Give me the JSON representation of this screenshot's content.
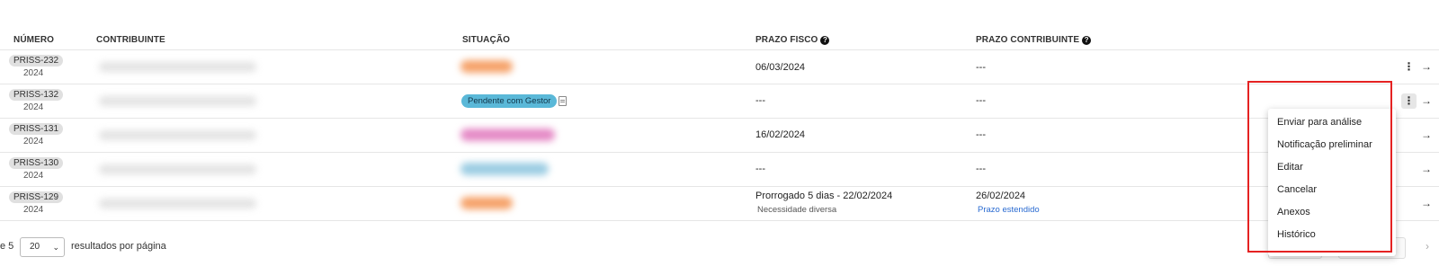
{
  "table": {
    "headers": {
      "numero": "NÚMERO",
      "contribuinte": "CONTRIBUINTE",
      "situacao": "SITUAÇÃO",
      "prazo_fisco": "PRAZO FISCO",
      "prazo_contribuinte": "PRAZO CONTRIBUINTE"
    },
    "rows": [
      {
        "id": "PRISS-232",
        "year": "2024",
        "prazo_fisco": "06/03/2024",
        "prazo_fisco_note": "",
        "prazo_contribuinte": "---",
        "prazo_contribuinte_note": ""
      },
      {
        "id": "PRISS-132",
        "year": "2024",
        "status_label": "Pendente com Gestor",
        "prazo_fisco": "---",
        "prazo_fisco_note": "",
        "prazo_contribuinte": "---",
        "prazo_contribuinte_note": ""
      },
      {
        "id": "PRISS-131",
        "year": "2024",
        "prazo_fisco": "16/02/2024",
        "prazo_fisco_note": "",
        "prazo_contribuinte": "---",
        "prazo_contribuinte_note": ""
      },
      {
        "id": "PRISS-130",
        "year": "2024",
        "prazo_fisco": "---",
        "prazo_fisco_note": "",
        "prazo_contribuinte": "---",
        "prazo_contribuinte_note": ""
      },
      {
        "id": "PRISS-129",
        "year": "2024",
        "prazo_fisco": "Prorrogado 5 dias - 22/02/2024",
        "prazo_fisco_note": "Necessidade diversa",
        "prazo_contribuinte": "26/02/2024",
        "prazo_contribuinte_note": "Prazo estendido"
      }
    ]
  },
  "icons": {
    "help": "question-circle-icon",
    "kebab": "more-vertical-icon",
    "arrow": "arrow-right-icon",
    "document": "document-icon",
    "kebab_glyph": "⋮",
    "arrow_glyph": "→",
    "help_glyph": "?",
    "chevron_glyph": "⌄",
    "pager_glyph": "›"
  },
  "context_menu": {
    "items": [
      "Enviar para análise",
      "Notificação preliminar",
      "Editar",
      "Cancelar",
      "Anexos",
      "Histórico"
    ]
  },
  "pagination": {
    "prefix": "e 5",
    "page_size": "20",
    "suffix": "resultados por página"
  },
  "colors": {
    "status_blue": "#5ab8d8",
    "status_orange": "#f6a36b",
    "status_pink": "#e58ac6",
    "highlight_red": "#e52222",
    "link_blue": "#2a6bd1"
  }
}
